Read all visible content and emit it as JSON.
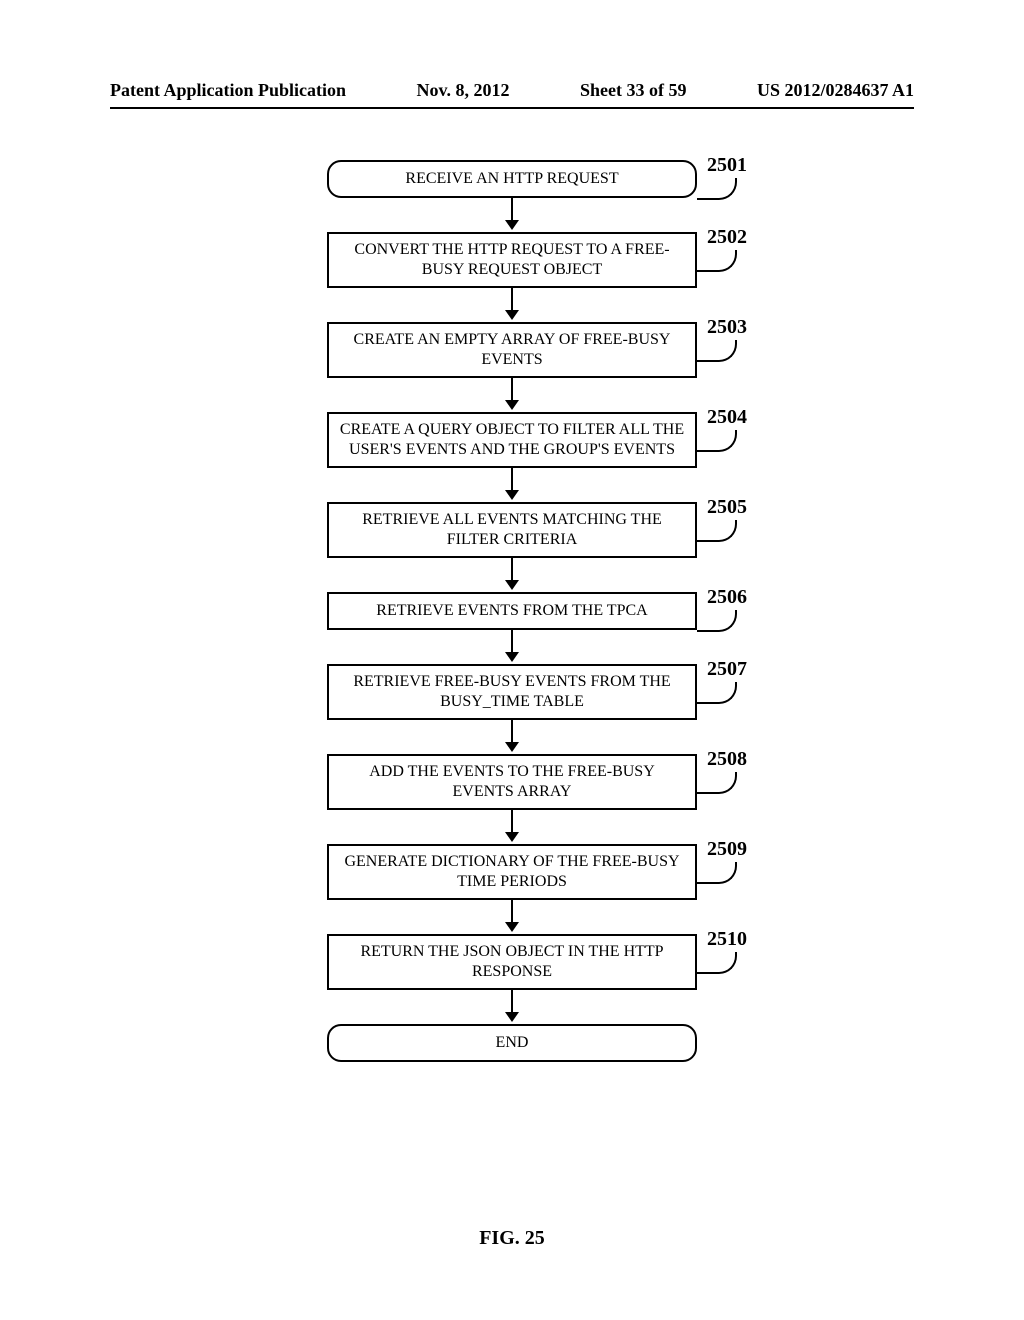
{
  "header": {
    "left": "Patent Application Publication",
    "date": "Nov. 8, 2012",
    "sheet": "Sheet 33 of 59",
    "pubno": "US 2012/0284637 A1"
  },
  "figure_caption": "FIG. 25",
  "steps": [
    {
      "text": "RECEIVE AN HTTP REQUEST",
      "label": "2501",
      "terminator": true,
      "tall": false
    },
    {
      "text": "CONVERT THE HTTP REQUEST TO A FREE-BUSY REQUEST OBJECT",
      "label": "2502",
      "terminator": false,
      "tall": true
    },
    {
      "text": "CREATE AN EMPTY ARRAY OF FREE-BUSY EVENTS",
      "label": "2503",
      "terminator": false,
      "tall": true
    },
    {
      "text": "CREATE A QUERY OBJECT TO FILTER ALL THE USER'S EVENTS AND THE GROUP'S EVENTS",
      "label": "2504",
      "terminator": false,
      "tall": true
    },
    {
      "text": "RETRIEVE ALL EVENTS MATCHING THE FILTER CRITERIA",
      "label": "2505",
      "terminator": false,
      "tall": true
    },
    {
      "text": "RETRIEVE EVENTS FROM THE TPCA",
      "label": "2506",
      "terminator": false,
      "tall": false
    },
    {
      "text": "RETRIEVE FREE-BUSY EVENTS FROM THE BUSY_TIME TABLE",
      "label": "2507",
      "terminator": false,
      "tall": true
    },
    {
      "text": "ADD THE EVENTS TO THE FREE-BUSY EVENTS ARRAY",
      "label": "2508",
      "terminator": false,
      "tall": true
    },
    {
      "text": "GENERATE DICTIONARY OF THE FREE-BUSY TIME PERIODS",
      "label": "2509",
      "terminator": false,
      "tall": true
    },
    {
      "text": "RETURN THE JSON OBJECT IN THE HTTP RESPONSE",
      "label": "2510",
      "terminator": false,
      "tall": true
    },
    {
      "text": "END",
      "label": "",
      "terminator": true,
      "tall": false
    }
  ]
}
